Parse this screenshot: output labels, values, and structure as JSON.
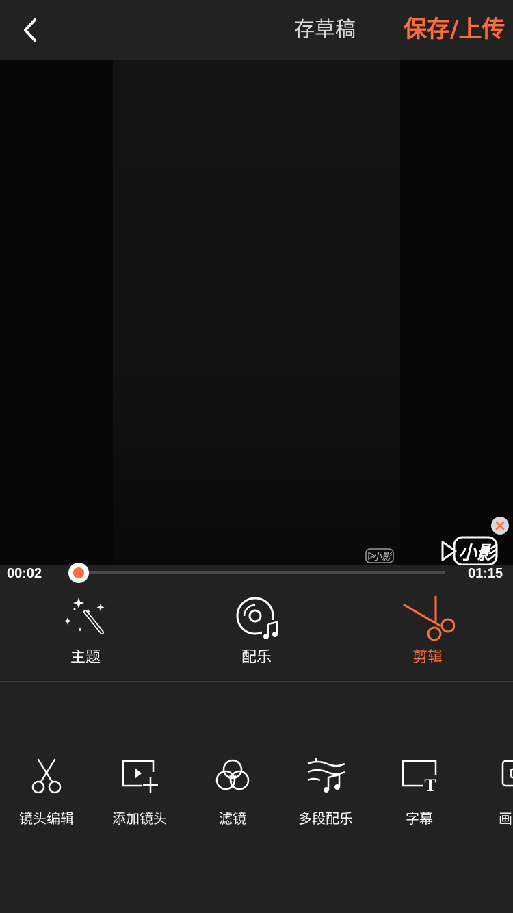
{
  "header": {
    "draft_label": "存草稿",
    "save_label": "保存/上传"
  },
  "player": {
    "current_time": "00:02",
    "total_time": "01:15",
    "progress": 0.0,
    "watermark_small": "小影",
    "watermark_big": "小影"
  },
  "main_tabs": [
    {
      "label": "主题",
      "icon": "magic-wand-icon",
      "active": false
    },
    {
      "label": "配乐",
      "icon": "music-disc-icon",
      "active": false
    },
    {
      "label": "剪辑",
      "icon": "scissors-icon",
      "active": true
    }
  ],
  "tools": [
    {
      "label": "镜头编辑",
      "icon": "scissors-icon"
    },
    {
      "label": "添加镜头",
      "icon": "add-clip-icon"
    },
    {
      "label": "滤镜",
      "icon": "filter-icon"
    },
    {
      "label": "多段配乐",
      "icon": "multi-music-icon"
    },
    {
      "label": "字幕",
      "icon": "subtitle-icon"
    },
    {
      "label": "画中",
      "icon": "pip-icon"
    }
  ],
  "colors": {
    "accent": "#ff6e3a",
    "background": "#222222",
    "text": "#ffffff"
  }
}
